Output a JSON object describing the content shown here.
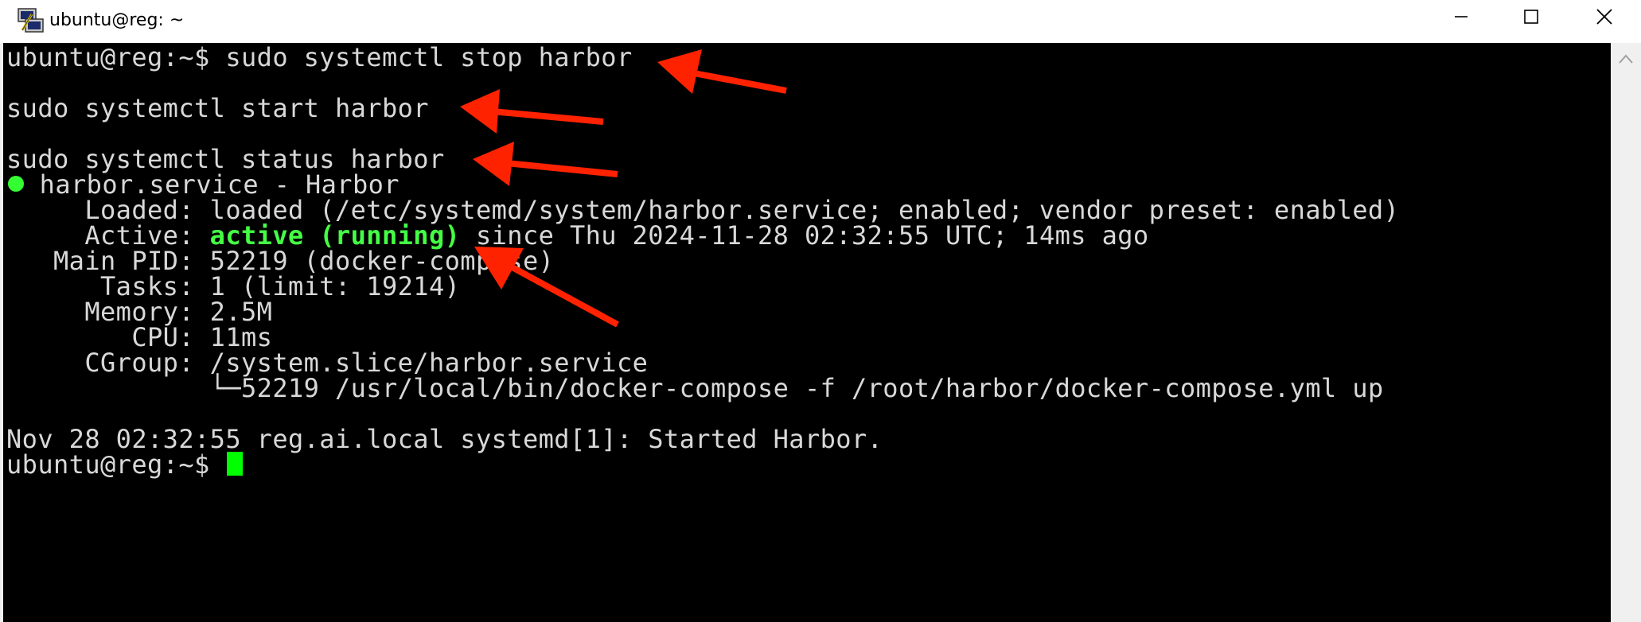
{
  "window": {
    "title": "ubuntu@reg: ~",
    "controls": {
      "minimize_icon": "minimize-icon",
      "maximize_icon": "maximize-icon",
      "close_icon": "close-icon"
    }
  },
  "terminal": {
    "lines": [
      "ubuntu@reg:~$ sudo systemctl stop harbor",
      "",
      "sudo systemctl start harbor",
      "",
      "sudo systemctl status harbor",
      " harbor.service - Harbor",
      "     Loaded: loaded (/etc/systemd/system/harbor.service; enabled; vendor preset: enabled)",
      "     Active: ",
      "   Main PID: 52219 (docker-compose)",
      "      Tasks: 1 (limit: 19214)",
      "     Memory: 2.5M",
      "        CPU: 11ms",
      "     CGroup: /system.slice/harbor.service",
      "             └─52219 /usr/local/bin/docker-compose -f /root/harbor/docker-compose.yml up",
      "",
      "Nov 28 02:32:55 reg.ai.local systemd[1]: Started Harbor.",
      "ubuntu@reg:~$ "
    ],
    "active_status": "active (running)",
    "active_suffix": " since Thu 2024-11-28 02:32:55 UTC; 14ms ago"
  },
  "colors": {
    "background": "#000000",
    "text": "#d8d8d8",
    "status_green": "#44ff44",
    "cursor": "#00ff00",
    "arrow": "#ff2200"
  }
}
